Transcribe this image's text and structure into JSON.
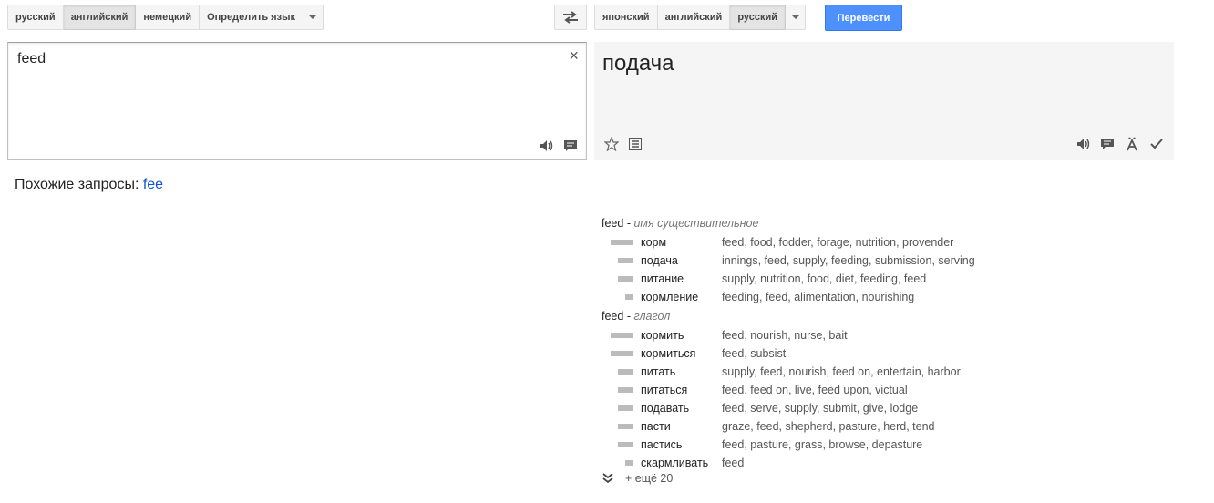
{
  "source_langs": [
    "русский",
    "английский",
    "немецкий",
    "Определить язык"
  ],
  "target_langs": [
    "японский",
    "английский",
    "русский"
  ],
  "translate_label": "Перевести",
  "source": {
    "text": "feed",
    "clear": "×"
  },
  "result": {
    "text": "подача"
  },
  "related": {
    "label": "Похожие запросы: ",
    "link": "fee"
  },
  "dict": {
    "noun": {
      "word": "feed",
      "dash": "-",
      "pos": "имя существительное",
      "entries": [
        {
          "w": "корм",
          "syn": "feed, food, fodder, forage, nutrition, provender",
          "freq": 3
        },
        {
          "w": "подача",
          "syn": "innings, feed, supply, feeding, submission, serving",
          "freq": 2
        },
        {
          "w": "питание",
          "syn": "supply, nutrition, food, diet, feeding, feed",
          "freq": 2
        },
        {
          "w": "кормление",
          "syn": "feeding, feed, alimentation, nourishing",
          "freq": 1
        }
      ]
    },
    "verb": {
      "word": "feed",
      "dash": "-",
      "pos": "глагол",
      "entries": [
        {
          "w": "кормить",
          "syn": "feed, nourish, nurse, bait",
          "freq": 3
        },
        {
          "w": "кормиться",
          "syn": "feed, subsist",
          "freq": 3
        },
        {
          "w": "питать",
          "syn": "supply, feed, nourish, feed on, entertain, harbor",
          "freq": 2
        },
        {
          "w": "питаться",
          "syn": "feed, feed on, live, feed upon, victual",
          "freq": 2
        },
        {
          "w": "подавать",
          "syn": "feed, serve, supply, submit, give, lodge",
          "freq": 2
        },
        {
          "w": "пасти",
          "syn": "graze, feed, shepherd, pasture, herd, tend",
          "freq": 2
        },
        {
          "w": "пастись",
          "syn": "feed, pasture, grass, browse, depasture",
          "freq": 2
        },
        {
          "w": "скармливать",
          "syn": "feed",
          "freq": 1
        }
      ]
    },
    "more": "+ ещё 20"
  },
  "icons": {
    "swap": "swap-icon",
    "clear": "close-icon",
    "speaker": "speaker-icon",
    "chat": "chat-bubble-icon",
    "star": "star-icon",
    "list": "list-icon",
    "umlaut": "a-umlaut-icon",
    "check": "check-icon",
    "expand": "double-chevron-down-icon"
  },
  "colors": {
    "accent": "#4d90fe",
    "link": "#1155cc"
  }
}
